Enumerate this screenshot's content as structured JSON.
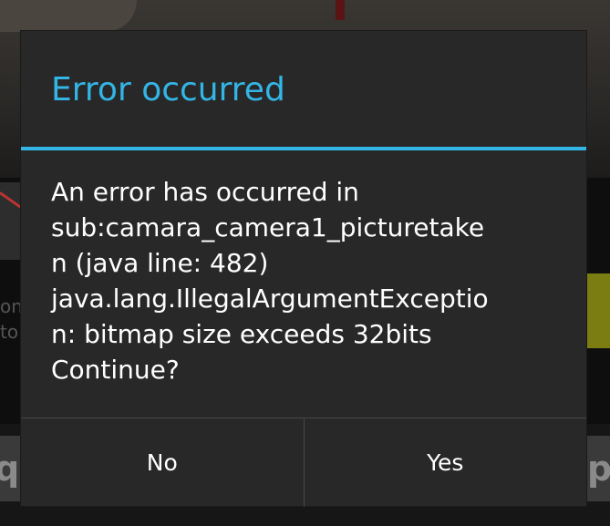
{
  "dialog": {
    "title": "Error occurred",
    "message_lines": [
      "An error has occurred in",
      "sub:camara_camera1_picturetake",
      "n (java line: 482)",
      "java.lang.IllegalArgumentExceptio",
      "n: bitmap size exceeds 32bits",
      "Continue?"
    ],
    "buttons": {
      "negative": "No",
      "positive": "Yes"
    }
  },
  "background": {
    "left_text": "on\nto",
    "key_left": "q",
    "key_right": "p"
  },
  "colors": {
    "accent": "#33b5e5",
    "dialog_bg": "#282828",
    "text": "#ffffff"
  }
}
